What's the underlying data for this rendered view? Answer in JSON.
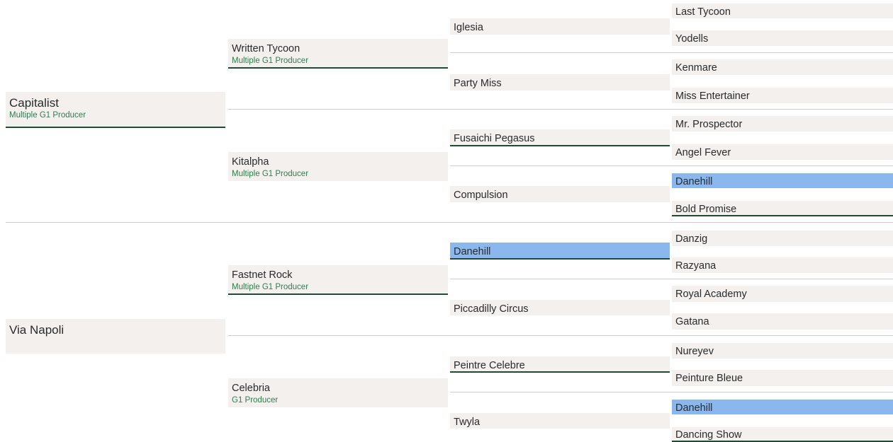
{
  "pedigree": {
    "gen1": [
      {
        "name": "Capitalist",
        "sub": "Multiple G1 Producer"
      },
      {
        "name": "Via Napoli",
        "sub": ""
      }
    ],
    "gen2": [
      {
        "name": "Written Tycoon",
        "sub": "Multiple G1 Producer"
      },
      {
        "name": "Kitalpha",
        "sub": "Multiple G1 Producer"
      },
      {
        "name": "Fastnet Rock",
        "sub": "Multiple G1 Producer"
      },
      {
        "name": "Celebria",
        "sub": "G1 Producer"
      }
    ],
    "gen3": [
      {
        "name": "Iglesia"
      },
      {
        "name": "Party Miss"
      },
      {
        "name": "Fusaichi Pegasus"
      },
      {
        "name": "Compulsion"
      },
      {
        "name": "Danehill"
      },
      {
        "name": "Piccadilly Circus"
      },
      {
        "name": "Peintre Celebre"
      },
      {
        "name": "Twyla"
      }
    ],
    "gen4": [
      {
        "name": "Last Tycoon"
      },
      {
        "name": "Yodells"
      },
      {
        "name": "Kenmare"
      },
      {
        "name": "Miss Entertainer"
      },
      {
        "name": "Mr. Prospector"
      },
      {
        "name": "Angel Fever"
      },
      {
        "name": "Danehill"
      },
      {
        "name": "Bold Promise"
      },
      {
        "name": "Danzig"
      },
      {
        "name": "Razyana"
      },
      {
        "name": "Royal Academy"
      },
      {
        "name": "Gatana"
      },
      {
        "name": "Nureyev"
      },
      {
        "name": "Peinture Bleue"
      },
      {
        "name": "Danehill"
      },
      {
        "name": "Dancing Show"
      }
    ]
  },
  "colors": {
    "box": "#f3f0ed",
    "highlight": "#8ab8ee",
    "underline": "#1f4a33",
    "producer_text": "#2e7d4f",
    "divider": "#cfcfcf"
  }
}
